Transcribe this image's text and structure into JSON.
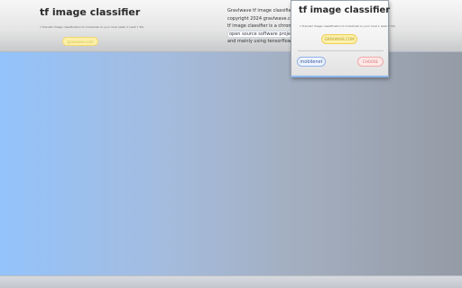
{
  "header": {
    "title": "tf image classifier",
    "subtitle": "1 Transfer Image classification to modelinet on your local (web) 1 (web 7 50)",
    "cta_label": "gravwave.com"
  },
  "about": {
    "lines": [
      "Gravlwave tf image classifier",
      "copyright 2024 gravlwave.com",
      "tf image classifier is a chrome",
      "open source software project",
      "and mainly using tensorflowjs"
    ]
  },
  "popup": {
    "title": "tf image classifier",
    "subtitle": "1 Transfer Image classification to modelinet on your local 1 (web 7 50)",
    "site_button": "GRAVWAVE.COM",
    "model_label": "mobilenet",
    "choose_label": "CHOOSE"
  },
  "colors": {
    "accent_yellow": "#fbf1ad",
    "accent_blue": "#8fb0e8",
    "accent_red": "#f0a7a7",
    "background_left": "#93c3fb",
    "background_right": "#959ba6"
  }
}
